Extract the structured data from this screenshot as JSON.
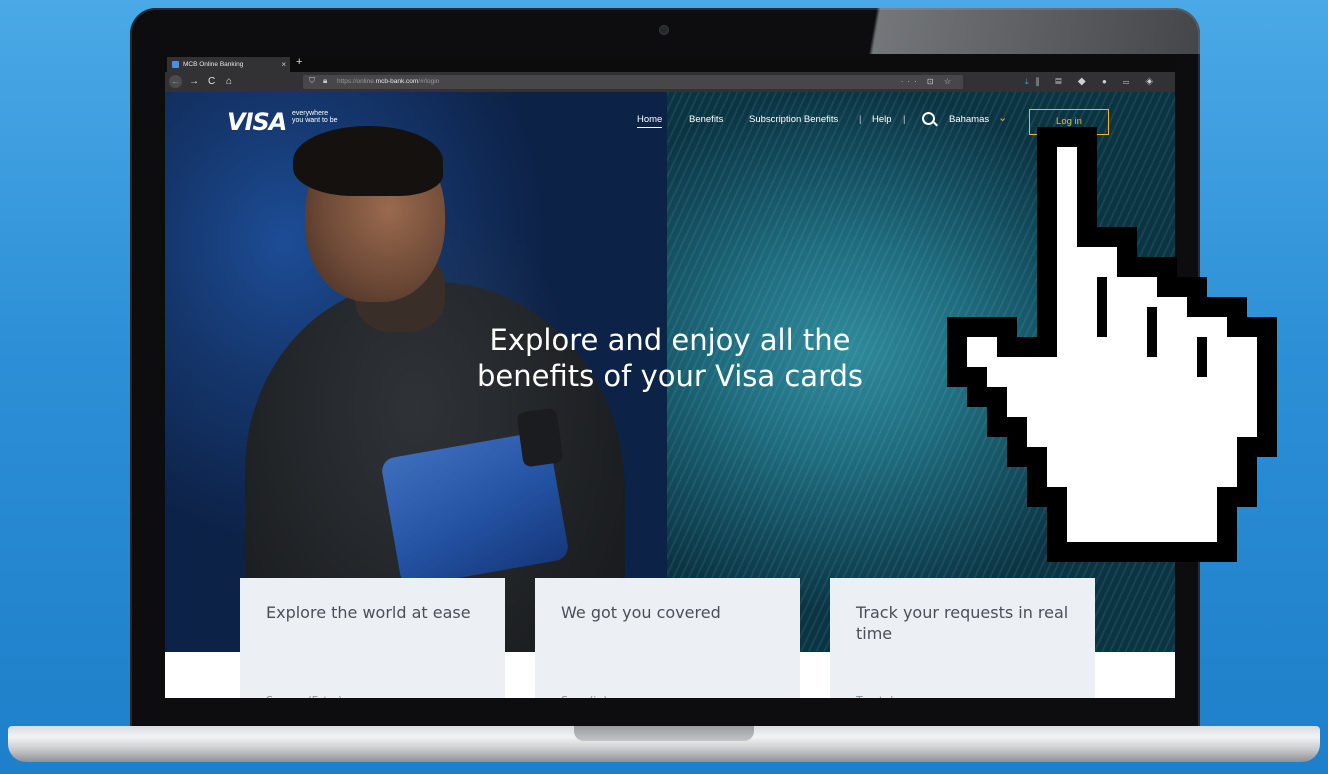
{
  "browser": {
    "tab_title": "MCB Online Banking",
    "tab_close": "×",
    "new_tab": "+",
    "url_prefix": "https://online.",
    "url_domain": "mcb-bank.com",
    "url_path": "/#/login",
    "url_actions": "··· ⊡ ☆",
    "nav_back": "←",
    "nav_forward": "→",
    "nav_reload": "C",
    "nav_home": "⌂"
  },
  "site": {
    "logo": "VISA",
    "tagline_line1": "everywhere",
    "tagline_line2": "you want to be",
    "nav": [
      {
        "label": "Home"
      },
      {
        "label": "Benefits"
      },
      {
        "label": "Subscription Benefits"
      },
      {
        "label": "Help"
      }
    ],
    "nav_separator": "|",
    "country": "Bahamas",
    "login_label": "Log in"
  },
  "hero": {
    "title_line1": "Explore and enjoy all the",
    "title_line2": "benefits of your Visa cards"
  },
  "cards": [
    {
      "title": "Explore the world at ease",
      "sub": "Se...e...(F..t.r.)"
    },
    {
      "title": "We got you covered",
      "sub": "S...r..(i..)"
    },
    {
      "title": "Track your requests in real time",
      "sub": "T.....t..l"
    }
  ],
  "colors": {
    "background": "#2d8fd6",
    "accent_gold": "#f5b51c",
    "card_bg": "#eceff3"
  },
  "icons": [
    "search-icon",
    "chevron-down-icon",
    "pixel-hand-cursor-icon",
    "lock-icon",
    "shield-icon"
  ]
}
